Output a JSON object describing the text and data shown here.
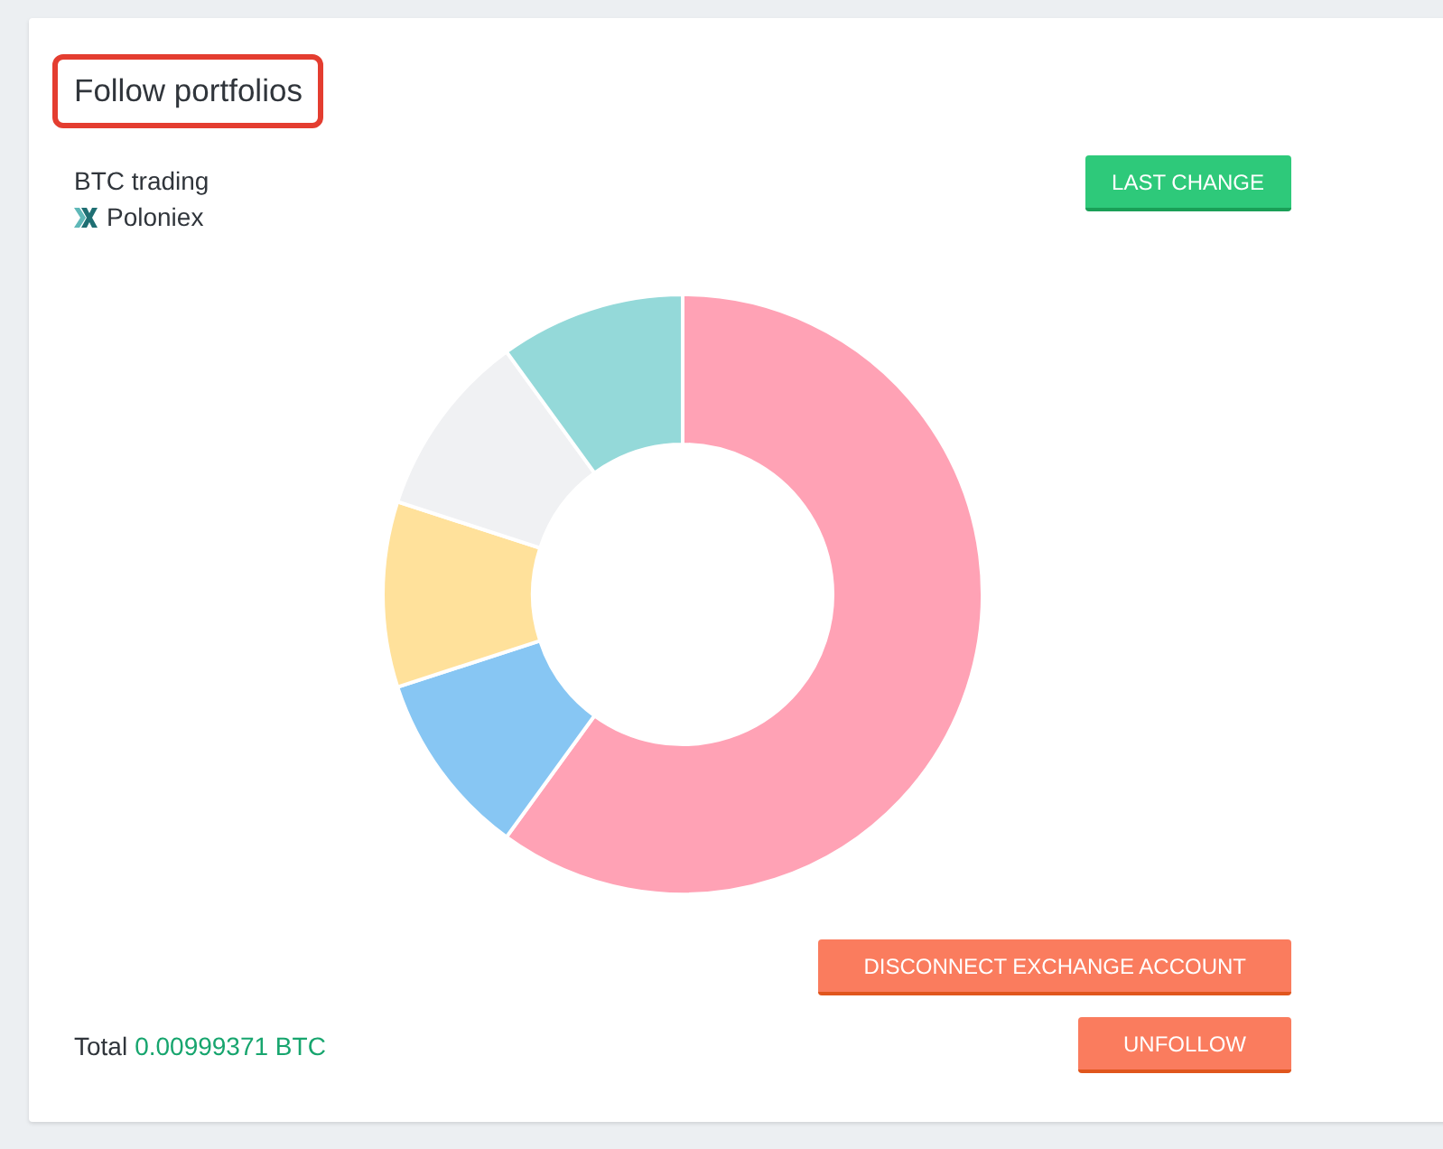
{
  "panel": {
    "title": "Follow portfolios"
  },
  "portfolio": {
    "name": "BTC trading",
    "exchange": "Poloniex"
  },
  "actions": {
    "last_change": "LAST CHANGE",
    "disconnect": "DISCONNECT EXCHANGE ACCOUNT",
    "unfollow": "UNFOLLOW"
  },
  "total": {
    "label": "Total",
    "value": "0.00999371 BTC"
  }
}
